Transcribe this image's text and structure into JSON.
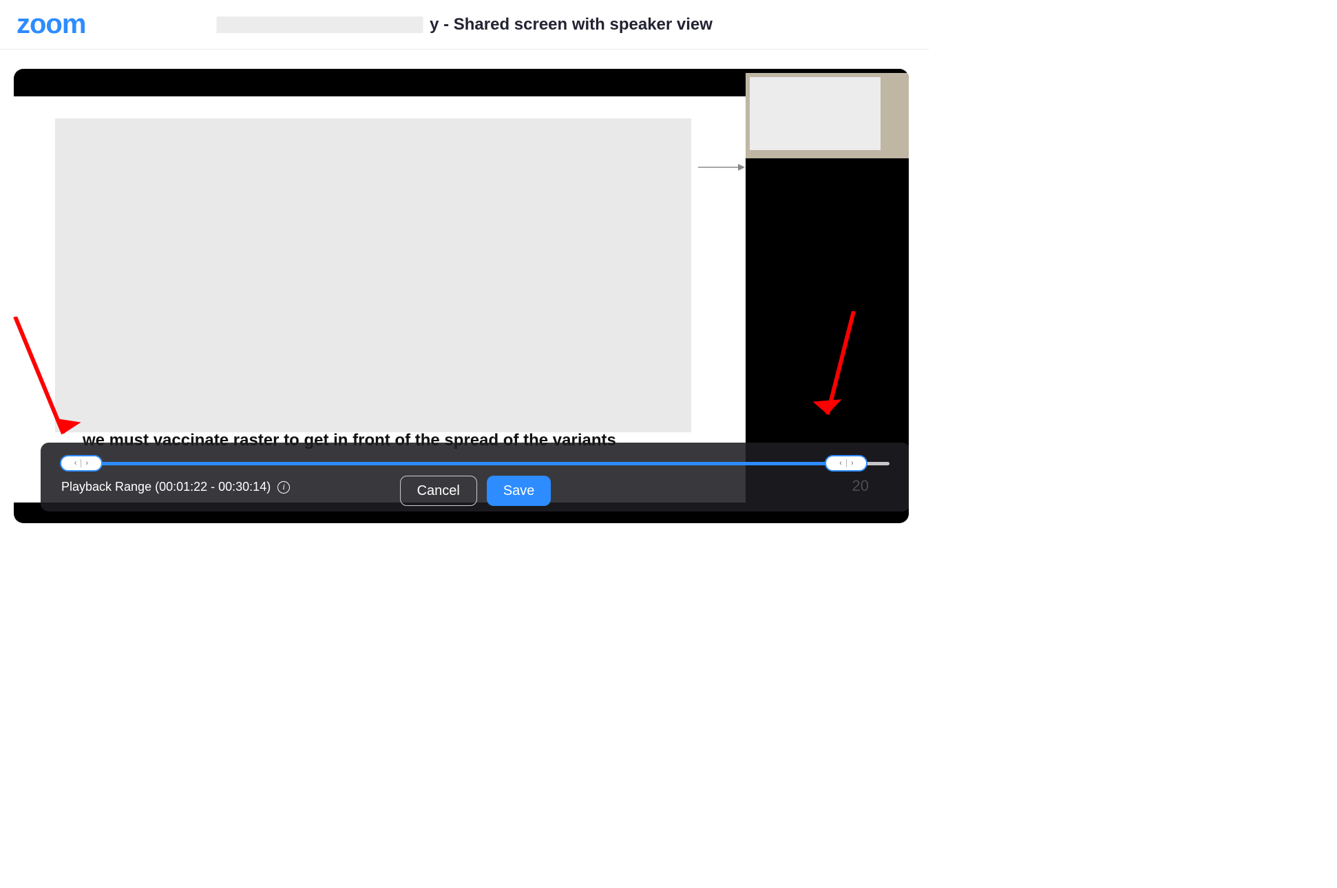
{
  "brand": {
    "logo_text": "zoom"
  },
  "header": {
    "title_suffix": "y - Shared screen with speaker view"
  },
  "slide": {
    "caption_text": "we must vaccinate raster to get in front of the spread of the variants"
  },
  "range": {
    "label_prefix": "Playback Range",
    "start_time": "00:01:22",
    "end_time": "00:30:14",
    "track_start_pct": 2.4,
    "track_end_pct": 94.8,
    "ghost_number": "20"
  },
  "buttons": {
    "cancel": "Cancel",
    "save": "Save"
  },
  "colors": {
    "accent": "#2d8cff"
  }
}
